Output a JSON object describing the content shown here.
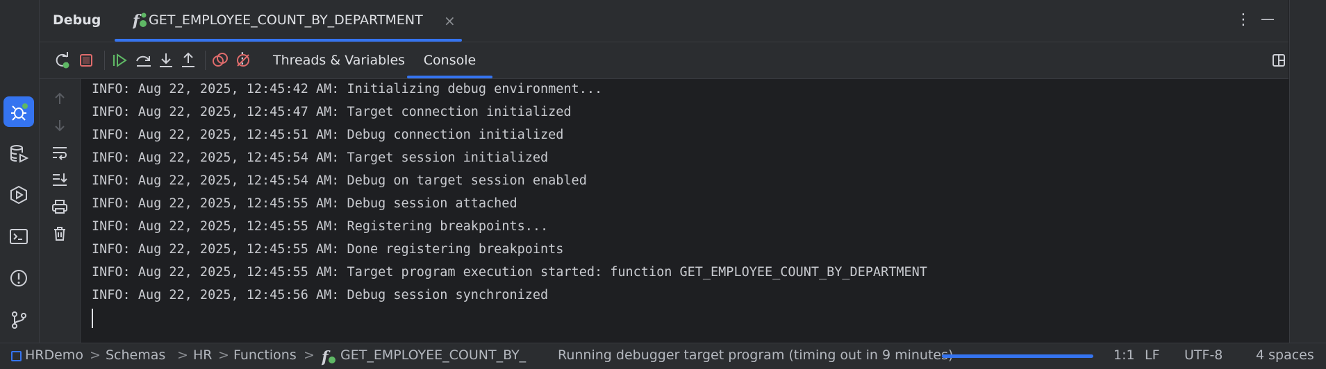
{
  "header": {
    "title": "Debug",
    "tab_label": "GET_EMPLOYEE_COUNT_BY_DEPARTMENT",
    "tab_close": "×",
    "more": "⋮",
    "minimize": "—"
  },
  "toolbar": {
    "tabs": [
      {
        "label": "Threads & Variables",
        "active": false
      },
      {
        "label": "Console",
        "active": true
      }
    ],
    "more": "⋮"
  },
  "console": {
    "lines": [
      "INFO: Aug 22, 2025, 12:45:42 AM: Initializing debug environment...",
      "INFO: Aug 22, 2025, 12:45:47 AM: Target connection initialized",
      "INFO: Aug 22, 2025, 12:45:51 AM: Debug connection initialized",
      "INFO: Aug 22, 2025, 12:45:54 AM: Target session initialized",
      "INFO: Aug 22, 2025, 12:45:54 AM: Debug on target session enabled",
      "INFO: Aug 22, 2025, 12:45:55 AM: Debug session attached",
      "INFO: Aug 22, 2025, 12:45:55 AM: Registering breakpoints...",
      "INFO: Aug 22, 2025, 12:45:55 AM: Done registering breakpoints",
      "INFO: Aug 22, 2025, 12:45:55 AM: Target program execution started: function GET_EMPLOYEE_COUNT_BY_DEPARTMENT",
      "INFO: Aug 22, 2025, 12:45:56 AM: Debug session synchronized"
    ]
  },
  "status": {
    "breadcrumbs": [
      "HRDemo",
      "Schemas",
      "HR",
      "Functions",
      "GET_EMPLOYEE_COUNT_BY_"
    ],
    "separator": ">",
    "message": "Running debugger target program (timing out in 9 minutes)",
    "position": "1:1",
    "line_ending": "LF",
    "encoding": "UTF-8",
    "indent": "4 spaces"
  },
  "colors": {
    "accent": "#3574f0",
    "run_green": "#5fb865",
    "stop_red": "#e06c6c"
  },
  "icons": {
    "activity": [
      "debug-icon",
      "database-run-icon",
      "services-icon",
      "terminal-icon",
      "problems-icon",
      "git-icon"
    ],
    "toolbar": [
      "rerun-icon",
      "stop-icon",
      "resume-icon",
      "step-over-icon",
      "step-into-icon",
      "step-out-icon",
      "view-breakpoints-icon",
      "mute-breakpoints-icon",
      "more-icon",
      "layout-icon"
    ],
    "gutter": [
      "up-arrow-icon",
      "down-arrow-icon",
      "soft-wrap-icon",
      "scroll-to-end-icon",
      "print-icon",
      "clear-all-icon"
    ]
  }
}
